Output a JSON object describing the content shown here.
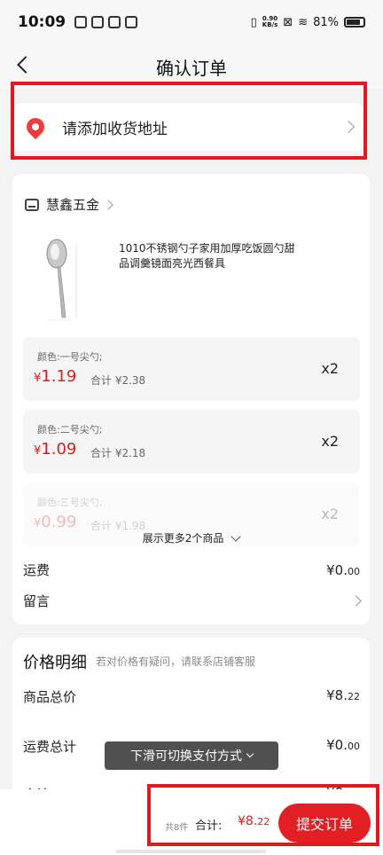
{
  "status_bar": {
    "time": "10:09",
    "speed_top": "0.90",
    "speed_bottom": "KB/s",
    "battery": "81%"
  },
  "header": {
    "title": "确认订单"
  },
  "address": {
    "label": "请添加收货地址"
  },
  "store": {
    "name": "慧鑫五金",
    "product_title": "1010不锈钢勺子家用加厚吃饭圆勺甜品调羹镜面亮光西餐具",
    "skus": [
      {
        "label": "颜色:一号尖勺;",
        "currency": "¥",
        "price": "1.19",
        "total": "合计 ¥2.38",
        "qty": "x2"
      },
      {
        "label": "颜色:二号尖勺;",
        "currency": "¥",
        "price": "1.09",
        "total": "合计 ¥2.18",
        "qty": "x2"
      },
      {
        "label": "颜色:三号尖勺;",
        "currency": "¥",
        "price": "0.99",
        "total": "合计 ¥1.98",
        "qty": "x2"
      }
    ],
    "more_label": "展示更多2个商品",
    "shipping_label": "运费",
    "shipping_value": "¥0.",
    "shipping_value_small": "00",
    "message_label": "留言"
  },
  "price_detail": {
    "title": "价格明细",
    "hint": "若对价格有疑问，请联系店铺客服",
    "rows": [
      {
        "label": "商品总价",
        "value": "¥8.",
        "value_small": "22"
      },
      {
        "label": "运费总计",
        "value": "¥0.",
        "value_small": "00"
      },
      {
        "label": "合计",
        "value": "¥8.",
        "value_small": "22"
      }
    ]
  },
  "toast": {
    "text": "下滑可切换支付方式"
  },
  "bottom_bar": {
    "count": "共8件",
    "total_label": "合计:",
    "total_value": "¥8.",
    "total_value_small": "22",
    "submit_label": "提交订单"
  },
  "colors": {
    "accent": "#e31f26",
    "price_red": "#d4201e"
  }
}
